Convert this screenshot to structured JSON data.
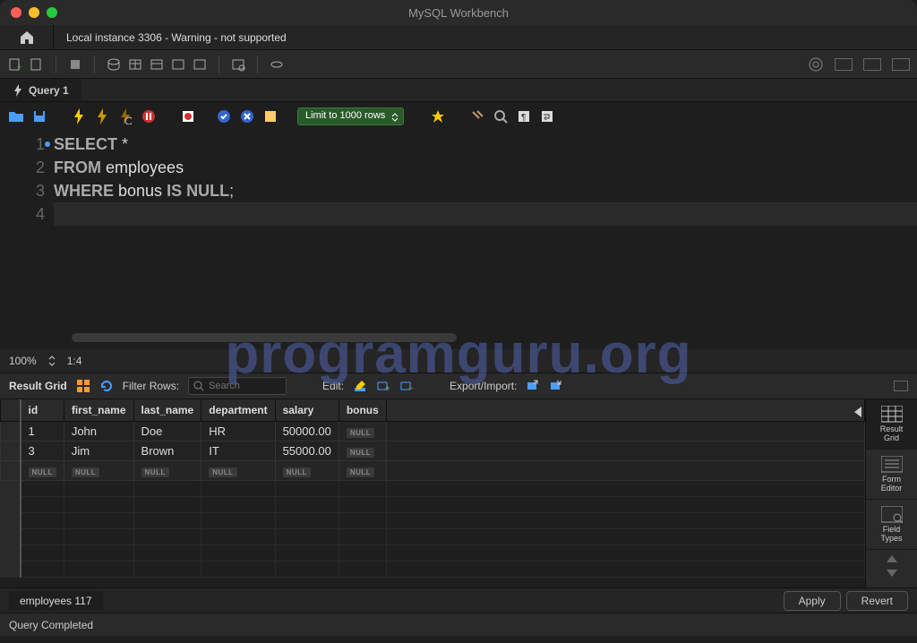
{
  "app_title": "MySQL Workbench",
  "connection_tab": "Local instance 3306 - Warning - not supported",
  "query_tab": "Query 1",
  "limit_label": "Limit to 1000 rows",
  "sql_lines": [
    "SELECT *",
    "FROM employees",
    "WHERE bonus IS NULL;",
    ""
  ],
  "zoom": {
    "percent": "100%",
    "pos": "1:4"
  },
  "result_toolbar": {
    "label": "Result Grid",
    "filter_label": "Filter Rows:",
    "filter_placeholder": "Search",
    "edit_label": "Edit:",
    "export_label": "Export/Import:"
  },
  "columns": [
    "id",
    "first_name",
    "last_name",
    "department",
    "salary",
    "bonus"
  ],
  "rows": [
    {
      "id": "1",
      "first_name": "John",
      "last_name": "Doe",
      "department": "HR",
      "salary": "50000.00",
      "bonus": null
    },
    {
      "id": "3",
      "first_name": "Jim",
      "last_name": "Brown",
      "department": "IT",
      "salary": "55000.00",
      "bonus": null
    }
  ],
  "side_panel": {
    "result_grid": "Result\nGrid",
    "form_editor": "Form\nEditor",
    "field_types": "Field\nTypes"
  },
  "bottom_tab": "employees 117",
  "apply_btn": "Apply",
  "revert_btn": "Revert",
  "status": "Query Completed",
  "watermark": "programguru.org"
}
